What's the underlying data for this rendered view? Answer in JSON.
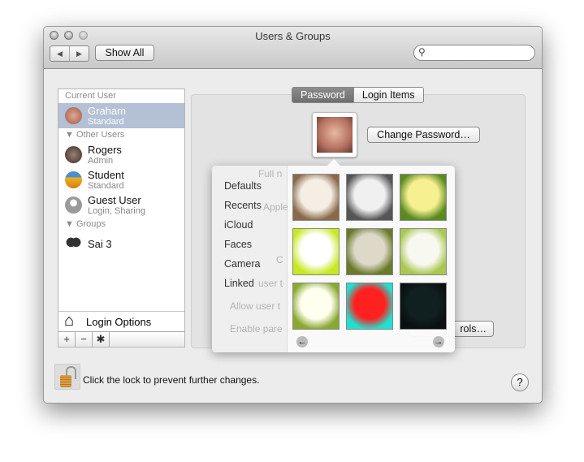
{
  "window": {
    "title": "Users & Groups"
  },
  "toolbar": {
    "back": "◀",
    "forward": "▶",
    "show_all": "Show All",
    "search_placeholder": "",
    "search_icon": "⚲"
  },
  "sidebar": {
    "current_header": "Current User",
    "current": {
      "name": "Graham",
      "role": "Standard",
      "avatar_color": "#b06a58"
    },
    "other_header": "Other Users",
    "others": [
      {
        "name": "Rogers",
        "role": "Admin",
        "avatar_color": "#5a4a44"
      },
      {
        "name": "Student",
        "role": "Standard",
        "avatar_color": "#e8a020"
      },
      {
        "name": "Guest User",
        "role": "Login, Sharing",
        "avatar_color": "#9a9a9a"
      }
    ],
    "groups_header": "Groups",
    "groups": [
      {
        "name": "Sai 3"
      }
    ],
    "login_options": "Login Options",
    "add": "+",
    "remove": "−",
    "settings": "✱"
  },
  "tabs": {
    "password": "Password",
    "login_items": "Login Items",
    "active": "Password"
  },
  "main": {
    "change_password": "Change Password…",
    "behind_button": "rols…",
    "ghost_text": [
      "Full n",
      "Apple",
      "C",
      "user t",
      "Allow user t",
      "Enable pare"
    ]
  },
  "popover": {
    "categories": [
      "Defaults",
      "Recents",
      "iCloud",
      "Faces",
      "Camera",
      "Linked"
    ],
    "thumbnails": [
      {
        "center": "#f4eee4",
        "edge": "#8a6a4a"
      },
      {
        "center": "#f0f0f0",
        "edge": "#555555"
      },
      {
        "center": "#f6f090",
        "edge": "#5a8a20"
      },
      {
        "center": "#ffffff",
        "edge": "#c8e820"
      },
      {
        "center": "#ddd8c8",
        "edge": "#6a7a2a"
      },
      {
        "center": "#f8f8f0",
        "edge": "#a8c850"
      },
      {
        "center": "#fffff0",
        "edge": "#8aa830"
      },
      {
        "center": "#ff2020",
        "edge": "#20e0d0"
      },
      {
        "center": "#102020",
        "edge": "#0a1010"
      }
    ],
    "prev": "←",
    "next": "→"
  },
  "footer": {
    "lock_text": "Click the lock to prevent further changes.",
    "help": "?"
  }
}
